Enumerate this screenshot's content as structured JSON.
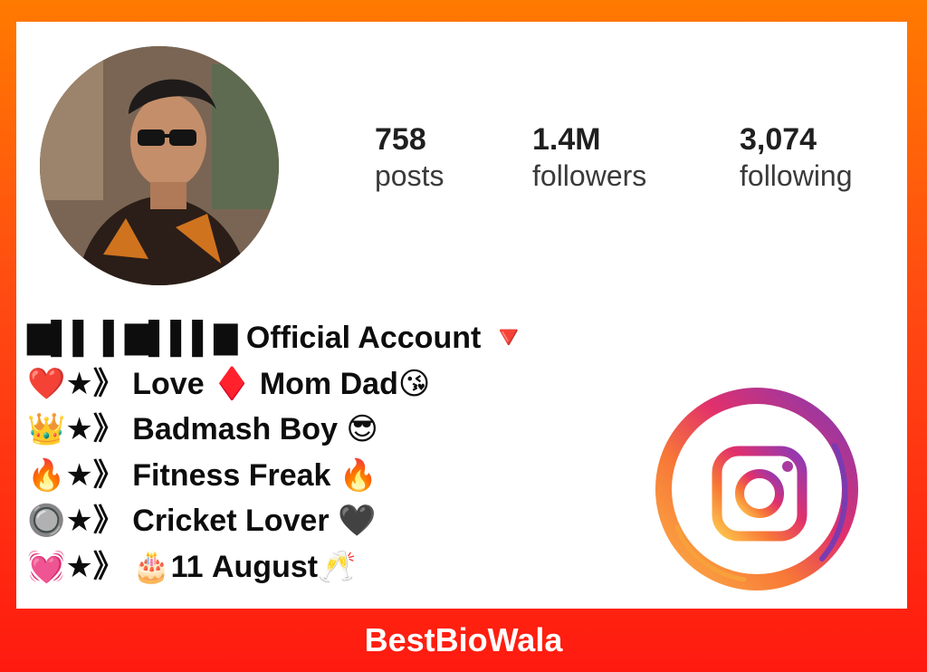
{
  "profile": {
    "avatar_alt": "profile photo",
    "stats": [
      {
        "value": "758",
        "label": "posts"
      },
      {
        "value": "1.4M",
        "label": "followers"
      },
      {
        "value": "3,074",
        "label": "following"
      }
    ],
    "bio_lines": [
      "▇▌▌ ▌▇▌▌▌▇ Official Account 🔻",
      "❤️★》 Love ♦️ Mom Dad😘",
      "👑★》 Badmash Boy 😎",
      "🔥★》 Fitness Freak 🔥",
      "🔘★》 Cricket Lover 🖤",
      "💓★》 🎂11 August🥂"
    ]
  },
  "brand": {
    "name": "BestBioWala",
    "logo_icon": "instagram-icon",
    "colors": {
      "orange": "#ff7a00",
      "red": "#ff1a10",
      "purple": "#8a3ab9",
      "pink": "#e1306c",
      "yellow": "#fcaf45"
    }
  }
}
